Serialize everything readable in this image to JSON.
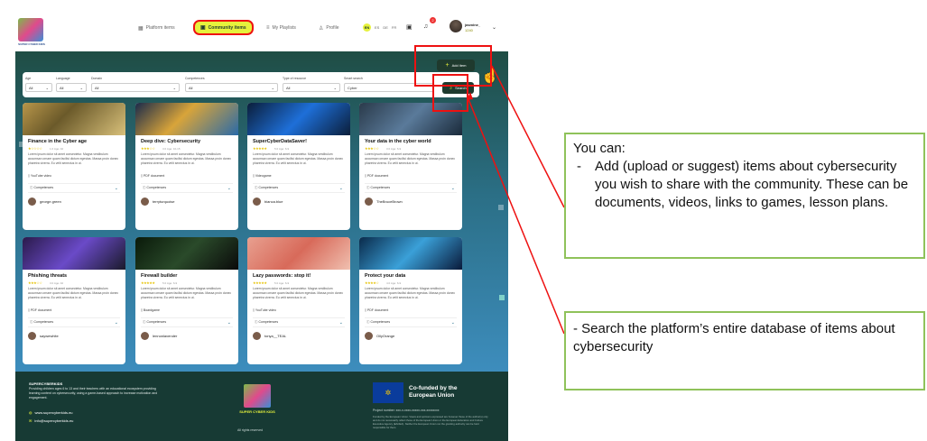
{
  "header": {
    "nav": [
      {
        "label": "Platform items",
        "icon": "grid-icon"
      },
      {
        "label": "Community items",
        "icon": "folder-icon",
        "active": true
      },
      {
        "label": "My Playlists",
        "icon": "list-icon"
      },
      {
        "label": "Profile",
        "icon": "user-icon"
      }
    ],
    "languages": [
      "EN",
      "ES",
      "DE",
      "FR"
    ],
    "user": {
      "name": "jasmine_",
      "points": "1240"
    },
    "notification_count": "2"
  },
  "filters": {
    "fields": [
      {
        "label": "Age",
        "value": "All"
      },
      {
        "label": "Language",
        "value": "All"
      },
      {
        "label": "Domain",
        "value": "All"
      },
      {
        "label": "Competences",
        "value": "All"
      },
      {
        "label": "Type of resource",
        "value": "All"
      },
      {
        "label": "Smart search",
        "value": "Cyber"
      }
    ],
    "add_label": "Add item",
    "search_label": "Search"
  },
  "cards": [
    {
      "title": "Finance in the Cyber age",
      "stars": "★☆☆☆☆",
      "meta": "1.0   Age: All",
      "desc": "Lorem ipsum dolor sit amet consectetur. Magna vestibulum accumsan ornare quam facilisi dictum egestas. Massa proin donec pharetra viverra. Eu velit senectus in ut.",
      "type": "YouTube video",
      "comp": "Competences",
      "user": "george.green"
    },
    {
      "title": "Deep dive: Cybersecurity",
      "stars": "★★★☆☆",
      "meta": "3.0   Age: 10-15",
      "desc": "Lorem ipsum dolor sit amet consectetur. Magna vestibulum accumsan ornare quam facilisi dictum egestas. Massa proin donec pharetra viverra. Eu velit senectus in ut.",
      "type": "PDF document",
      "comp": "Competences",
      "user": "terryturquoise"
    },
    {
      "title": "SuperCyberDataSaver!",
      "stars": "★★★★★",
      "meta": "5.0   Age: 6-9",
      "desc": "Lorem ipsum dolor sit amet consectetur. Magna vestibulum accumsan ornare quam facilisi dictum egestas. Massa proin donec pharetra viverra. Eu velit senectus in ut.",
      "type": "Videogame",
      "comp": "Competences",
      "user": "bianca.blue"
    },
    {
      "title": "Your data in the cyber world",
      "stars": "★★★☆☆",
      "meta": "3.0   Age: 6-9",
      "desc": "Lorem ipsum dolor sit amet consectetur. Magna vestibulum accumsan ornare quam facilisi dictum egestas. Massa proin donec pharetra viverra. Eu velit senectus in ut.",
      "type": "PDF document",
      "comp": "Competences",
      "user": "TheBruceBrown"
    },
    {
      "title": "Phishing threats",
      "stars": "★★★☆☆",
      "meta": "3.0   Age: All",
      "desc": "Lorem ipsum dolor sit amet consectetur. Magna vestibulum accumsan ornare quam facilisi dictum egestas. Massa proin donec pharetra viverra. Eu velit senectus in ut.",
      "type": "PDF document",
      "comp": "Competences",
      "user": "saywewhite"
    },
    {
      "title": "Firewall builder",
      "stars": "★★★★★",
      "meta": "5.0   Age: 6-9",
      "desc": "Lorem ipsum dolor sit amet consectetur. Magna vestibulum accumsan ornare quam facilisi dictum egestas. Massa proin donec pharetra viverra. Eu velit senectus in ut.",
      "type": "Boardgame",
      "comp": "Competences",
      "user": "lennonlavender"
    },
    {
      "title": "Lazy passwords: stop it!",
      "stars": "★★★★★",
      "meta": "5.0   Age: 6-9",
      "desc": "Lorem ipsum dolor sit amet consectetur. Magna vestibulum accumsan ornare quam facilisi dictum egestas. Massa proin donec pharetra viverra. Eu velit senectus in ut.",
      "type": "YouTube video",
      "comp": "Competences",
      "user": "tonya__TEAL"
    },
    {
      "title": "Protect your data",
      "stars": "★★★★☆",
      "meta": "4.0   Age: 6-9",
      "desc": "Lorem ipsum dolor sit amet consectetur. Magna vestibulum accumsan ornare quam facilisi dictum egestas. Massa proin donec pharetra viverra. Eu velit senectus in ut.",
      "type": "PDF document",
      "comp": "Competences",
      "user": "OllyOrange"
    }
  ],
  "footer": {
    "brand": "SUPERCYBERKIDS",
    "text": "Providing children ages 6 to 13 and their teachers with an educational ecosystem providing learning content on cybersecurity, using a game-based approach to increase motivation and engagement.",
    "website": "www.supercyberkids.eu",
    "email": "info@supercyberkids.eu",
    "logo_caption": "SUPER CYBER KIDS",
    "rights": "All rights reserved",
    "eu_text": "Co-funded by the European Union",
    "project": "Project number: xxx-x-xxxx-xxxxx-xxx-xxxxxxxx",
    "disclaimer": "Funded by the European Union. Views and opinions expressed are however those of the author(s) only and do not necessarily reflect those of the European Union or the European Education and Culture Executive Agency (EACEA). Neither the European Union nor the granting authority can be held responsible for them."
  },
  "callouts": {
    "box1_title": "You can:",
    "box1_bullet": "Add (upload or suggest) items about cybersecurity you wish to share with the community. These can be documents, videos, links to games, lesson plans.",
    "box1_dash": "-",
    "box2_text": "- Search the platform’s entire database of items about cybersecurity"
  },
  "colors": {
    "accent": "#e6f23c",
    "primary": "#1f3a2e",
    "annotation_red": "#e11111",
    "callout_border": "#8fc25a"
  }
}
